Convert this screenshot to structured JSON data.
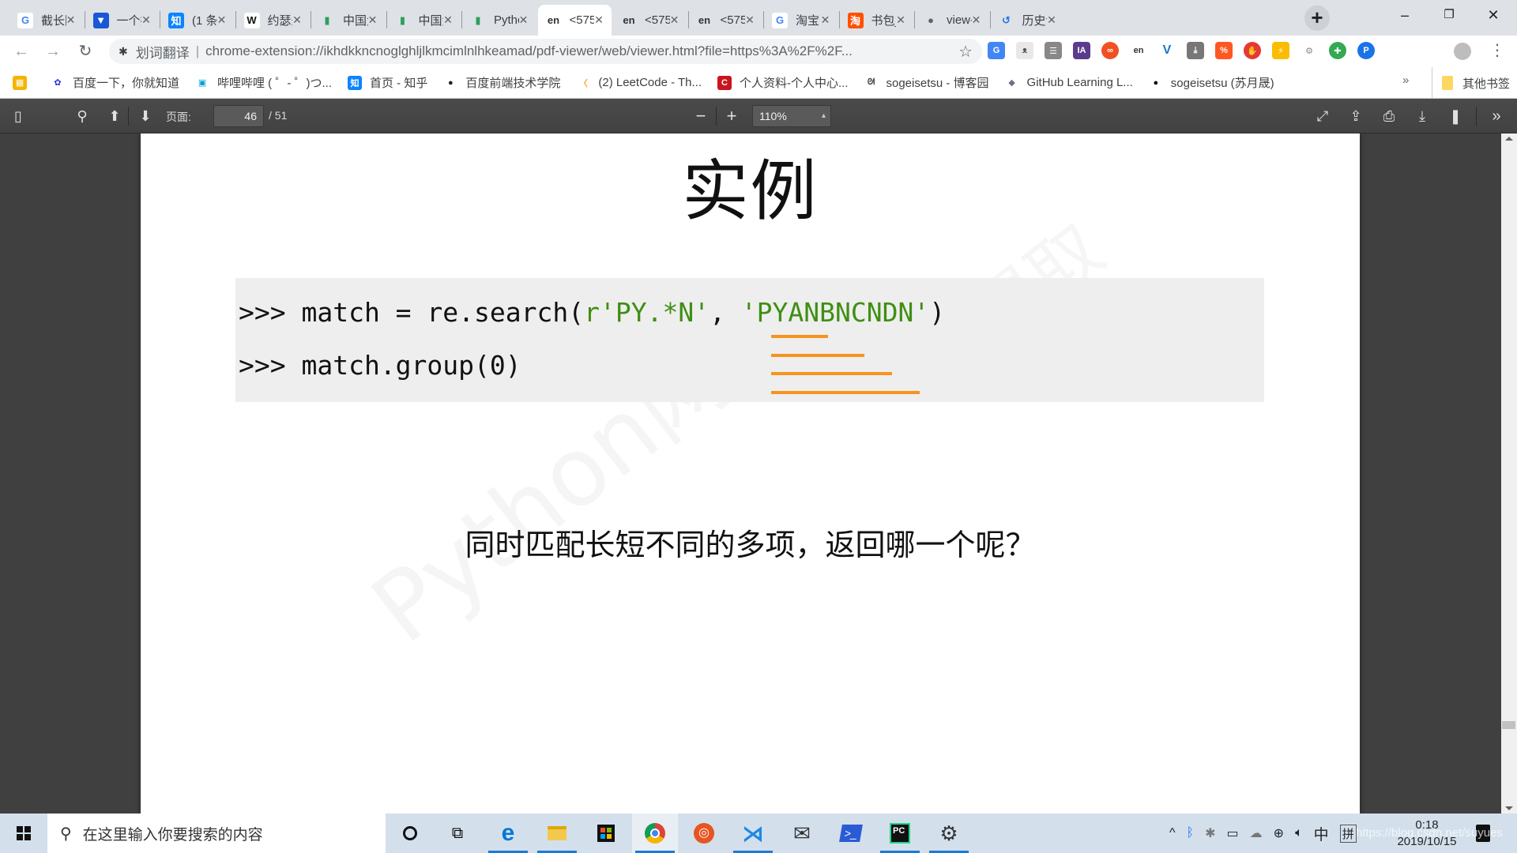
{
  "browser": {
    "tabs": [
      {
        "title": "截长图",
        "icon": "google-icon",
        "active": false
      },
      {
        "title": "一个操",
        "icon": "bookmark-app-icon",
        "active": false
      },
      {
        "title": "(1 条",
        "icon": "zhihu-icon",
        "active": false
      },
      {
        "title": "约瑟夫",
        "icon": "wikipedia-icon",
        "active": false
      },
      {
        "title": "中国大",
        "icon": "mooc-icon",
        "active": false
      },
      {
        "title": "中国大",
        "icon": "mooc-icon",
        "active": false
      },
      {
        "title": "Pytho",
        "icon": "mooc-icon",
        "active": false
      },
      {
        "title": "<575",
        "icon": "translate-en-icon",
        "active": true
      },
      {
        "title": "<575",
        "icon": "translate-en-icon",
        "active": false
      },
      {
        "title": "<575",
        "icon": "translate-en-icon",
        "active": false
      },
      {
        "title": "淘宝",
        "icon": "google-icon",
        "active": false
      },
      {
        "title": "书包_",
        "icon": "taobao-icon",
        "active": false
      },
      {
        "title": "view-",
        "icon": "globe-icon",
        "active": false
      },
      {
        "title": "历史记",
        "icon": "history-icon",
        "active": false
      }
    ],
    "tab_close_glyph": "✕",
    "new_tab_glyph": "+",
    "window_controls": {
      "minimize": "–",
      "maximize": "❐",
      "close": "✕"
    },
    "address": {
      "extension_label": "划词翻译",
      "url": "chrome-extension://ikhdkkncnoglghljlkmcimlnlhkeamad/pdf-viewer/web/viewer.html?file=https%3A%2F%2F..."
    },
    "bookmarks": [
      {
        "label": "",
        "icon": "apps-icon"
      },
      {
        "label": "百度一下，你就知道",
        "icon": "baidu-icon"
      },
      {
        "label": "哔哩哔哩 ( ゜- ゜)つ...",
        "icon": "bilibili-icon"
      },
      {
        "label": "首页 - 知乎",
        "icon": "zhihu-icon"
      },
      {
        "label": "百度前端技术学院",
        "icon": "ife-icon"
      },
      {
        "label": "(2) LeetCode - Th...",
        "icon": "leetcode-icon"
      },
      {
        "label": "个人资料-个人中心...",
        "icon": "csdn-icon"
      },
      {
        "label": "sogeisetsu - 博客园",
        "icon": "cnblogs-icon"
      },
      {
        "label": "GitHub Learning L...",
        "icon": "github-lab-icon"
      },
      {
        "label": "sogeisetsu (苏月晟)",
        "icon": "github-icon"
      }
    ],
    "bookmarks_overflow": "»",
    "other_bookmarks": "其他书签"
  },
  "pdf_viewer": {
    "page_label": "页面:",
    "current_page": "46",
    "total_pages": "/ 51",
    "zoom": "110%"
  },
  "slide": {
    "title": "实例",
    "code_prompt": ">>>",
    "code_line1_pre": " match = re.search(",
    "code_line1_regex": "r'PY.*N'",
    "code_line1_mid": ", ",
    "code_line1_string": "'PYANBNCNDN'",
    "code_line1_post": ")",
    "code_line2": " match.group(0)",
    "question": "同时匹配长短不同的多项，返回哪一个呢？",
    "watermark": "Python网络",
    "watermark2": "提取",
    "colors": {
      "string": "#3f8f12",
      "underline": "#f7941d",
      "code_bg": "#eeeeee"
    }
  },
  "taskbar": {
    "search_placeholder": "在这里输入你要搜索的内容",
    "apps": [
      "cortana",
      "task-view",
      "edge",
      "file-explorer",
      "store",
      "chrome",
      "ubuntu",
      "vscode",
      "mail",
      "powershell",
      "pycharm",
      "settings"
    ],
    "tray": {
      "ime_mode": "中",
      "ime_layout": "拼"
    },
    "time": "0:18",
    "date": "2019/10/15",
    "watermark": "https://blog.csdn.net/suyues"
  }
}
